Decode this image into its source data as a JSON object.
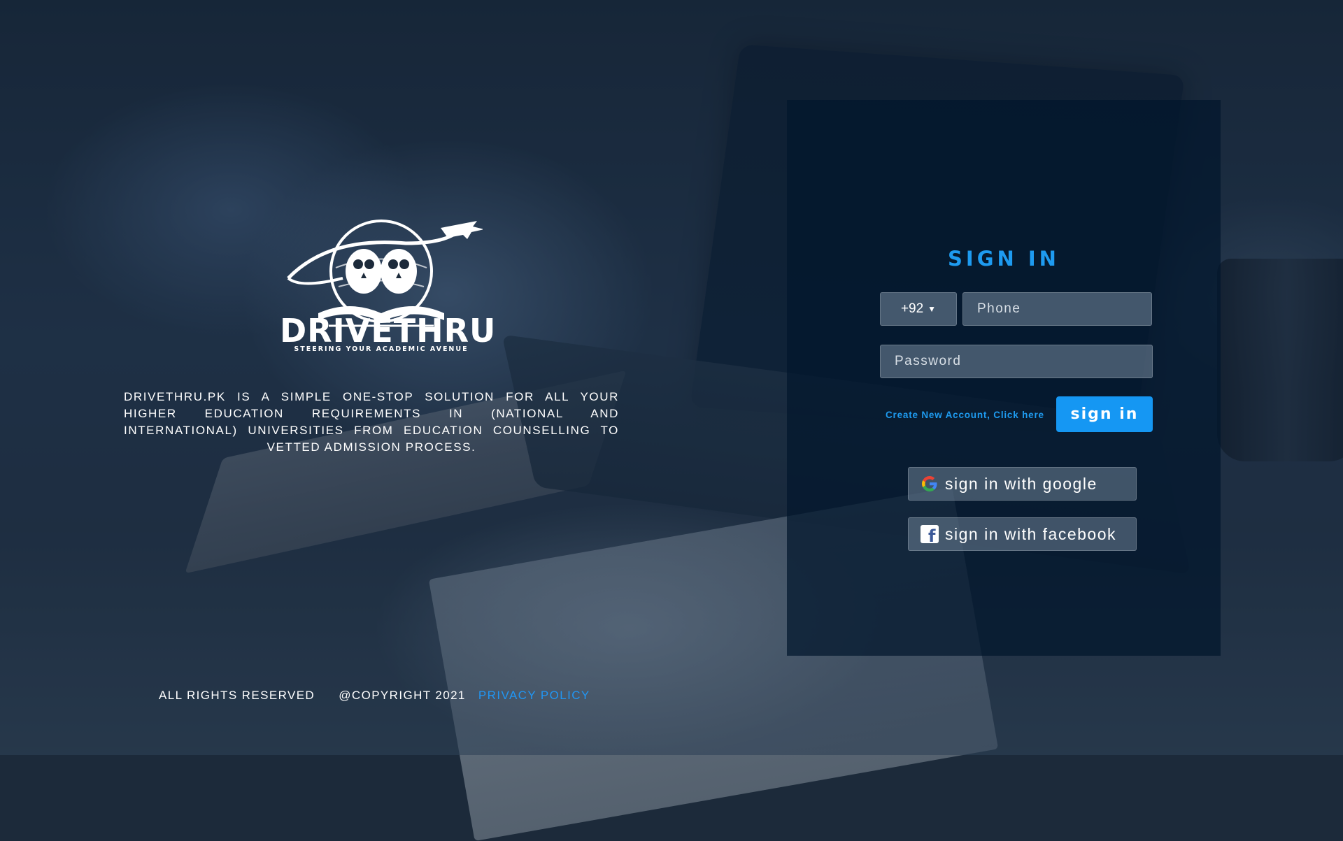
{
  "brand": {
    "name": "DRIVETHRU",
    "tagline": "STEERING YOUR ACADEMIC AVENUE",
    "description": "DRIVETHRU.PK IS A SIMPLE ONE-STOP SOLUTION FOR ALL YOUR HIGHER EDUCATION REQUIREMENTS IN (NATIONAL AND INTERNATIONAL) UNIVERSITIES FROM EDUCATION COUNSELLING TO VETTED ADMISSION PROCESS."
  },
  "footer": {
    "rights": "ALL RIGHTS RESERVED",
    "copyright": "@COPYRIGHT 2021",
    "privacy": "PRIVACY POLICY"
  },
  "signin": {
    "title": "SIGN IN",
    "country_code": "+92",
    "phone_placeholder": "Phone",
    "password_placeholder": "Password",
    "create_account": "Create New Account, Click here",
    "submit_label": "sign in",
    "google_label": "sign in with google",
    "facebook_label": "sign in with facebook"
  },
  "colors": {
    "accent": "#1e9bf0",
    "panel": "#02162d",
    "facebook": "#3b5998"
  },
  "icons": {
    "logo": "owl-globe-airplane-logo",
    "google": "google-g-icon",
    "facebook": "facebook-f-icon",
    "dropdown": "caret-down-icon"
  }
}
